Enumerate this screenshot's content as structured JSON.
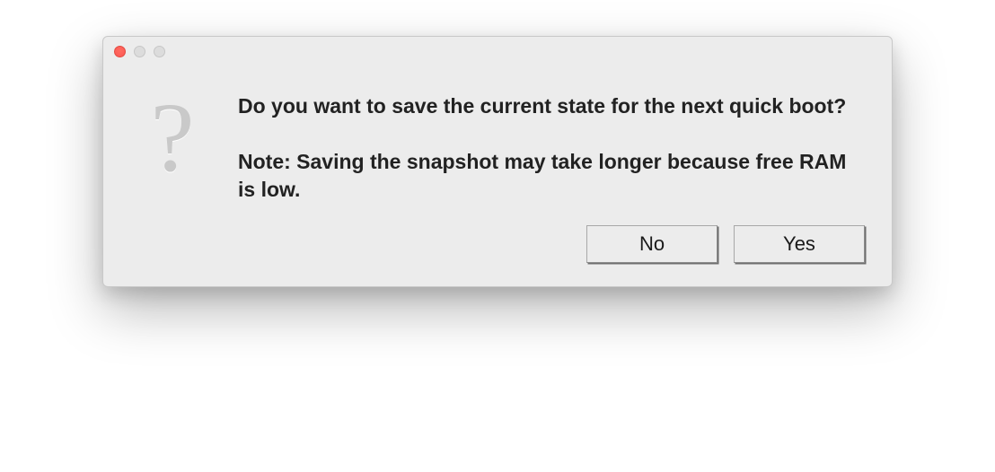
{
  "dialog": {
    "icon_semantic": "question-mark",
    "icon_glyph": "?",
    "message": "Do you want to save the current state for the next quick boot?\n\nNote: Saving the snapshot may take longer because free RAM is low.",
    "buttons": {
      "no": "No",
      "yes": "Yes"
    }
  }
}
